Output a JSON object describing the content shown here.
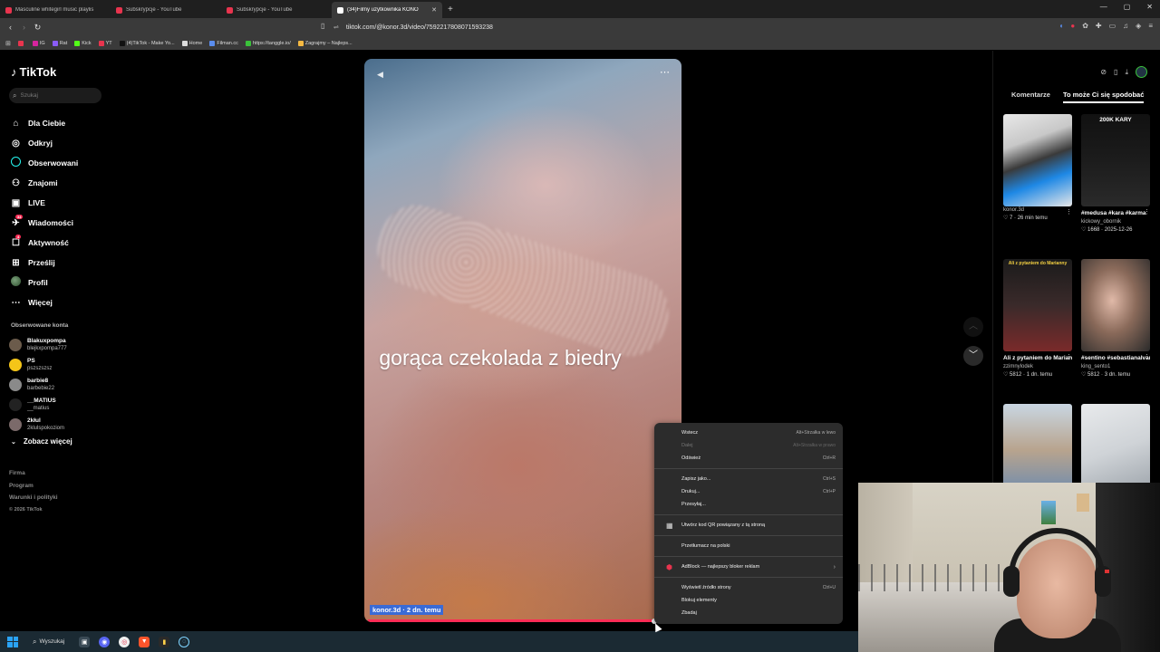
{
  "tabs": [
    {
      "title": "Masculine whitegirl music playlis",
      "color": "#e8344e",
      "active": false
    },
    {
      "title": "Subskrypcje - YouTube",
      "color": "#e8344e",
      "active": false
    },
    {
      "title": "Subskrypcje - YouTube",
      "color": "#e8344e",
      "active": false
    },
    {
      "title": "(34)Filmy użytkownika KONO",
      "color": "#ffffff",
      "active": true
    }
  ],
  "address": {
    "url": "tiktok.com/@konor.3d/video/7592217808071593238"
  },
  "bookmarks": [
    {
      "label": "",
      "color": "#e8344e"
    },
    {
      "label": "IG",
      "color": "#d6249f"
    },
    {
      "label": "Rat",
      "color": "#8a5cf6"
    },
    {
      "label": "Kick",
      "color": "#53fc18"
    },
    {
      "label": "YT",
      "color": "#e8344e"
    },
    {
      "label": "(4)TikTok - Make Yo...",
      "color": "#111111"
    },
    {
      "label": "Home",
      "color": "#dddddd"
    },
    {
      "label": "Filman.cc",
      "color": "#5a8dee"
    },
    {
      "label": "https://tanggle.io/",
      "color": "#3ac23a"
    },
    {
      "label": "Zagrajmy – Najleps...",
      "color": "#f5b942"
    }
  ],
  "tiktok": {
    "logo": "TikTok",
    "search_placeholder": "Szukaj",
    "nav": [
      {
        "label": "Dla Ciebie",
        "icon": "home-icon",
        "glyph": "⌂",
        "badge": ""
      },
      {
        "label": "Odkryj",
        "icon": "compass-icon",
        "glyph": "◎",
        "badge": ""
      },
      {
        "label": "Obserwowani",
        "icon": "following-icon",
        "glyph": "",
        "badge": ""
      },
      {
        "label": "Znajomi",
        "icon": "friends-icon",
        "glyph": "⚇",
        "badge": ""
      },
      {
        "label": "LIVE",
        "icon": "live-icon",
        "glyph": "▣",
        "badge": ""
      },
      {
        "label": "Wiadomości",
        "icon": "messages-icon",
        "glyph": "✈",
        "badge": "34"
      },
      {
        "label": "Aktywność",
        "icon": "activity-icon",
        "glyph": "☐",
        "badge": "4"
      },
      {
        "label": "Prześlij",
        "icon": "upload-icon",
        "glyph": "⊞",
        "badge": ""
      },
      {
        "label": "Profil",
        "icon": "profile-icon",
        "glyph": "",
        "badge": ""
      },
      {
        "label": "Więcej",
        "icon": "more-icon",
        "glyph": "⋯",
        "badge": ""
      }
    ],
    "followed_title": "Obserwowane konta",
    "followed": [
      {
        "name": "Blakuxpompa",
        "handle": "blejkxpompa777",
        "color": "#6b5b4b"
      },
      {
        "name": "PS",
        "handle": "pszszszsz",
        "color": "#f5c518"
      },
      {
        "name": "barbie8",
        "handle": "barbebie22",
        "color": "#8a8a8a"
      },
      {
        "name": "__MATIUS",
        "handle": "__matius",
        "color": "#222222"
      },
      {
        "name": "2kłul",
        "handle": "2klulspokoziom",
        "color": "#7b6a6a"
      }
    ],
    "see_more": "Zobacz więcej",
    "footer": [
      "Firma",
      "Program",
      "Warunki i polityki"
    ],
    "copyright": "© 2026 TikTok"
  },
  "video": {
    "caption": "gorąca czekolada z biedry",
    "author_line": "konor.3d · 2 dn. temu",
    "progress": 0.92
  },
  "right_panel": {
    "tabs": [
      "Komentarze",
      "To może Ci się spodobać"
    ],
    "cards": [
      {
        "overlay": "",
        "desc": "",
        "user": "konor.3d",
        "stats": "♡ 7 · 26 min temu",
        "bg": "linear-gradient(160deg,#e9e9e9 0%,#c8c8c8 30%,#3a3a3a 50%,#1e88e5 70%,#e8e8e8 100%)"
      },
      {
        "overlay": "200K KARY",
        "desc": "#medusa #kara #karma",
        "user": "kickowy_obornik",
        "stats": "♡ 1668 · 2025-12-26",
        "bg": "linear-gradient(180deg,#111 0%,#1c1c1c 50%,#2a2a2a 100%)"
      },
      {
        "overlay": "Ali z pytaniem do Marianny",
        "desc": "Ali z pytaniem do Marianny #aliSca...",
        "user": "zzimnylodek",
        "stats": "♡ 5812 · 1 dn. temu",
        "bg": "linear-gradient(180deg,#1b1b1b 0%,#3a2a2a 50%,#7a2a2a 100%)"
      },
      {
        "overlay": "",
        "desc": "#sentino #sebastianalvare...",
        "user": "king_sento1",
        "stats": "♡ 5812 · 3 dn. temu",
        "bg": "radial-gradient(ellipse at 45% 45%,#e0b9a8 0%,#8a6a5a 45%,#2a2a2a 100%)"
      },
      {
        "overlay": "",
        "desc": "",
        "user": "",
        "stats": "",
        "bg": "linear-gradient(180deg,#c9d6e2 0%,#b8a48e 50%,#6a8ab0 100%)"
      },
      {
        "overlay": "",
        "desc": "",
        "user": "",
        "stats": "",
        "bg": "linear-gradient(160deg,#e8eaec 0%,#cfd3d7 50%,#9aa1a8 100%)"
      }
    ]
  },
  "context_menu": {
    "groups": [
      [
        {
          "label": "Wstecz",
          "shortcut": "Alt+Strzałka w lewo",
          "disabled": false
        },
        {
          "label": "Dalej",
          "shortcut": "Alt+Strzałka w prawo",
          "disabled": true
        },
        {
          "label": "Odśwież",
          "shortcut": "Ctrl+R",
          "disabled": false
        }
      ],
      [
        {
          "label": "Zapisz jako...",
          "shortcut": "Ctrl+S",
          "disabled": false
        },
        {
          "label": "Drukuj...",
          "shortcut": "Ctrl+P",
          "disabled": false
        },
        {
          "label": "Przesyłaj...",
          "shortcut": "",
          "disabled": false
        }
      ],
      [
        {
          "label": "Utwórz kod QR powiązany z tą stroną",
          "shortcut": "",
          "disabled": false,
          "icon": "qr-code-icon"
        }
      ],
      [
        {
          "label": "Przetłumacz na polski",
          "shortcut": "",
          "disabled": false
        }
      ],
      [
        {
          "label": "AdBlock — najlepszy bloker reklam",
          "shortcut": "",
          "disabled": false,
          "icon": "adblock-icon",
          "submenu": true
        }
      ],
      [
        {
          "label": "Wyświetl źródło strony",
          "shortcut": "Ctrl+U",
          "disabled": false
        },
        {
          "label": "Blokuj elementy",
          "shortcut": "",
          "disabled": false
        },
        {
          "label": "Zbadaj",
          "shortcut": "",
          "disabled": false
        }
      ]
    ]
  },
  "taskbar": {
    "search_label": "Wyszukaj"
  }
}
